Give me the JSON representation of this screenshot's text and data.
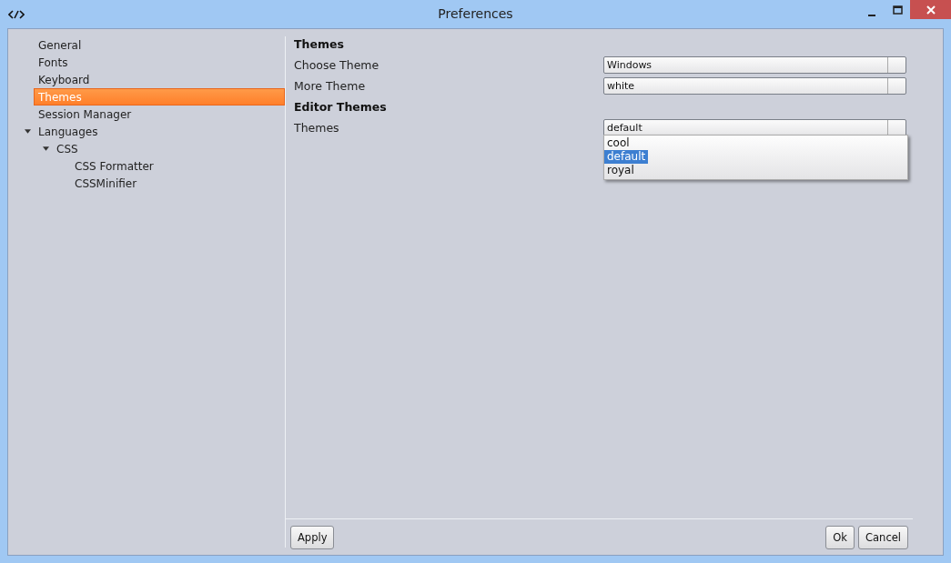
{
  "window": {
    "title": "Preferences"
  },
  "sidebar": {
    "items": [
      {
        "label": "General",
        "selected": false
      },
      {
        "label": "Fonts",
        "selected": false
      },
      {
        "label": "Keyboard",
        "selected": false
      },
      {
        "label": "Themes",
        "selected": true
      },
      {
        "label": "Session Manager",
        "selected": false
      },
      {
        "label": "Languages",
        "selected": false,
        "expanded": true,
        "children": [
          {
            "label": "CSS",
            "selected": false,
            "expanded": true,
            "children": [
              {
                "label": "CSS Formatter",
                "selected": false
              },
              {
                "label": "CSSMinifier",
                "selected": false
              }
            ]
          }
        ]
      }
    ]
  },
  "form": {
    "rows": [
      {
        "kind": "heading",
        "label": "Themes"
      },
      {
        "kind": "select",
        "label": "Choose Theme",
        "value": "Windows"
      },
      {
        "kind": "select",
        "label": "More Theme",
        "value": "white"
      },
      {
        "kind": "heading",
        "label": "Editor Themes"
      },
      {
        "kind": "select",
        "label": "Themes",
        "value": "default",
        "open": true,
        "options": [
          {
            "label": "cool",
            "selected": false
          },
          {
            "label": "default",
            "selected": true
          },
          {
            "label": "royal",
            "selected": false
          }
        ]
      }
    ]
  },
  "buttons": {
    "left": [
      "Apply"
    ],
    "right": [
      "Ok",
      "Cancel"
    ]
  }
}
